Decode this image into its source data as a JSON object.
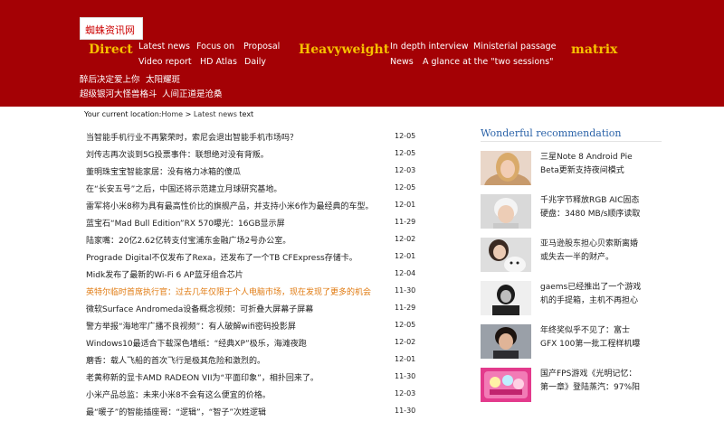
{
  "logo": {
    "text": "蜘蛛资讯网"
  },
  "nav": {
    "categories": [
      "Direct",
      "Heavyweight",
      "matrix"
    ],
    "direct_links": [
      "Latest news",
      "Focus on",
      "Proposal",
      "Video report",
      "HD Atlas",
      "Daily"
    ],
    "heavy_links": [
      "In depth interview",
      "Ministerial passage",
      "News",
      "A glance at the \"two sessions\""
    ]
  },
  "hot_links": [
    "醉后决定爱上你",
    "太阳耀斑",
    "超级银河大怪兽格斗",
    "人间正道是沧桑"
  ],
  "breadcrumb": {
    "prefix": "Your current location:",
    "home": "Home",
    "sep": " > ",
    "section": "Latest news",
    "tail": " text"
  },
  "news": [
    {
      "title": "当智能手机行业不再繁荣时，索尼会退出智能手机市场吗？",
      "date": "12-05"
    },
    {
      "title": "刘传志再次谈到5G投票事件：联想绝对没有背叛。",
      "date": "12-05"
    },
    {
      "title": "董明珠宝宝智能家居：没有格力冰箱的傻瓜",
      "date": "12-03"
    },
    {
      "title": "在“长安五号”之后，中国还将示范建立月球研究基地。",
      "date": "12-05"
    },
    {
      "title": "雷军将小米8称为具有最高性价比的旗舰产品，并支持小米6作为最经典的车型。",
      "date": "12-01"
    },
    {
      "title": "蓝宝石“Mad Bull Edition”RX 570曝光：16GB显示屏",
      "date": "11-29"
    },
    {
      "title": "陆家嘴：20亿2.62亿转支付宝浦东金融广场2号办公室。",
      "date": "12-02"
    },
    {
      "title": "Prograde Digital不仅发布了Rexa，还发布了一个TB CFExpress存储卡。",
      "date": "12-01"
    },
    {
      "title": "Midk发布了最新的Wi-Fi 6 AP蓝牙组合芯片",
      "date": "12-04"
    },
    {
      "title": "英特尔临时首席执行官：过去几年仅限于个人电脑市场，现在发现了更多的机会",
      "date": "11-30",
      "highlight": true
    },
    {
      "title": "微软Surface Andromeda设备概念视频：可折叠大屏幕子屏幕",
      "date": "11-29"
    },
    {
      "title": "警方举报“海地牢广播不良视频”：有人破解wifi密码投影屏",
      "date": "12-05"
    },
    {
      "title": "Windows10最适合下载深色墙纸：“经典XP”极乐，海滩夜跑",
      "date": "12-02"
    },
    {
      "title": "蘑香：载人飞船的首次飞行是极其危险和激烈的。",
      "date": "12-01"
    },
    {
      "title": "老黄称新的显卡AMD RADEON VII为“平面印象”，相扑回来了。",
      "date": "11-30"
    },
    {
      "title": "小米产品总监：未来小米8不会有这么便宜的价格。",
      "date": "12-03"
    },
    {
      "title": "最“暖子”的智能插座哥：“逻辑”，“智子”次姓逻辑",
      "date": "11-30"
    }
  ],
  "recommend": {
    "title": "Wonderful recommendation",
    "items": [
      {
        "text": "三星Note 8 Android Pie Beta更新支持夜间模式",
        "icon": "photo-woman-blonde"
      },
      {
        "text": "千兆字节释放RGB AIC固态硬盘：3480 MB/s顺序读取",
        "icon": "photo-man-white-hair"
      },
      {
        "text": "亚马逊股东担心贝索斯离婚或失去一半的财产。",
        "icon": "photo-woman-with-dog"
      },
      {
        "text": "gaems已经推出了一个游戏机的手提箱，主机不再担心丢失了",
        "icon": "photo-man-bw"
      },
      {
        "text": "年终奖似乎不见了：富士GFX 100第一批工程样机曝光",
        "icon": "photo-man-portrait"
      },
      {
        "text": "国产FPS游戏《光明记忆：第一章》登陆蒸汽：97%阳性率",
        "icon": "photo-pink-figurines"
      }
    ]
  },
  "colors": {
    "header_bg": "#a40105",
    "category": "#f6c000",
    "link_highlight": "#e07a10",
    "rec_title": "#2a62a8"
  }
}
